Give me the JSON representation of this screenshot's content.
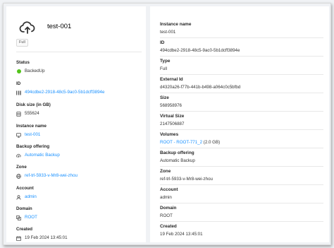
{
  "resource": {
    "icon": "cloud-upload-icon",
    "name": "test-001",
    "type_tag": "Full"
  },
  "left": {
    "status_label": "Status",
    "status_value": "BackedUp",
    "status_color": "#52c41a",
    "id_label": "ID",
    "id_value": "494cdbe2-2918-48c5-9ac0-5b1dcff3894e",
    "disk_label": "Disk size (in GB)",
    "disk_value": "555624",
    "instance_label": "Instance name",
    "instance_value": "test-001",
    "backup_offering_label": "Backup offering",
    "backup_offering_value": "Automatic Backup",
    "zone_label": "Zone",
    "zone_value": "ref-trl-5933-v-Mr8-wei-zhou",
    "account_label": "Account",
    "account_value": "admin",
    "domain_label": "Domain",
    "domain_value": "ROOT",
    "created_label": "Created",
    "created_value": "19 Feb 2024 13:45:01"
  },
  "right": {
    "items": [
      {
        "label": "Instance name",
        "value": "test-001"
      },
      {
        "label": "ID",
        "value": "494cdbe2-2918-48c5-9ac0-5b1dcff3894e"
      },
      {
        "label": "Type",
        "value": "Full"
      },
      {
        "label": "External Id",
        "value": "d4320a26-f77b-441b-b498-a064c0c5bfbd"
      },
      {
        "label": "Size",
        "value": "568958976"
      },
      {
        "label": "Virtual Size",
        "value": "2147506887"
      },
      {
        "label": "Volumes",
        "value_link": "ROOT - ROOT-771_2",
        "value_suffix": " (2.0 GB)"
      },
      {
        "label": "Backup offering",
        "value": "Automatic Backup"
      },
      {
        "label": "Zone",
        "value": "ref-trl-5933-v-Mr8-wei-zhou"
      },
      {
        "label": "Account",
        "value": "admin"
      },
      {
        "label": "Domain",
        "value": "ROOT"
      },
      {
        "label": "Created",
        "value": "19 Feb 2024 13:45:01"
      }
    ]
  },
  "colors": {
    "link": "#1890ff",
    "status_ok": "#52c41a"
  }
}
